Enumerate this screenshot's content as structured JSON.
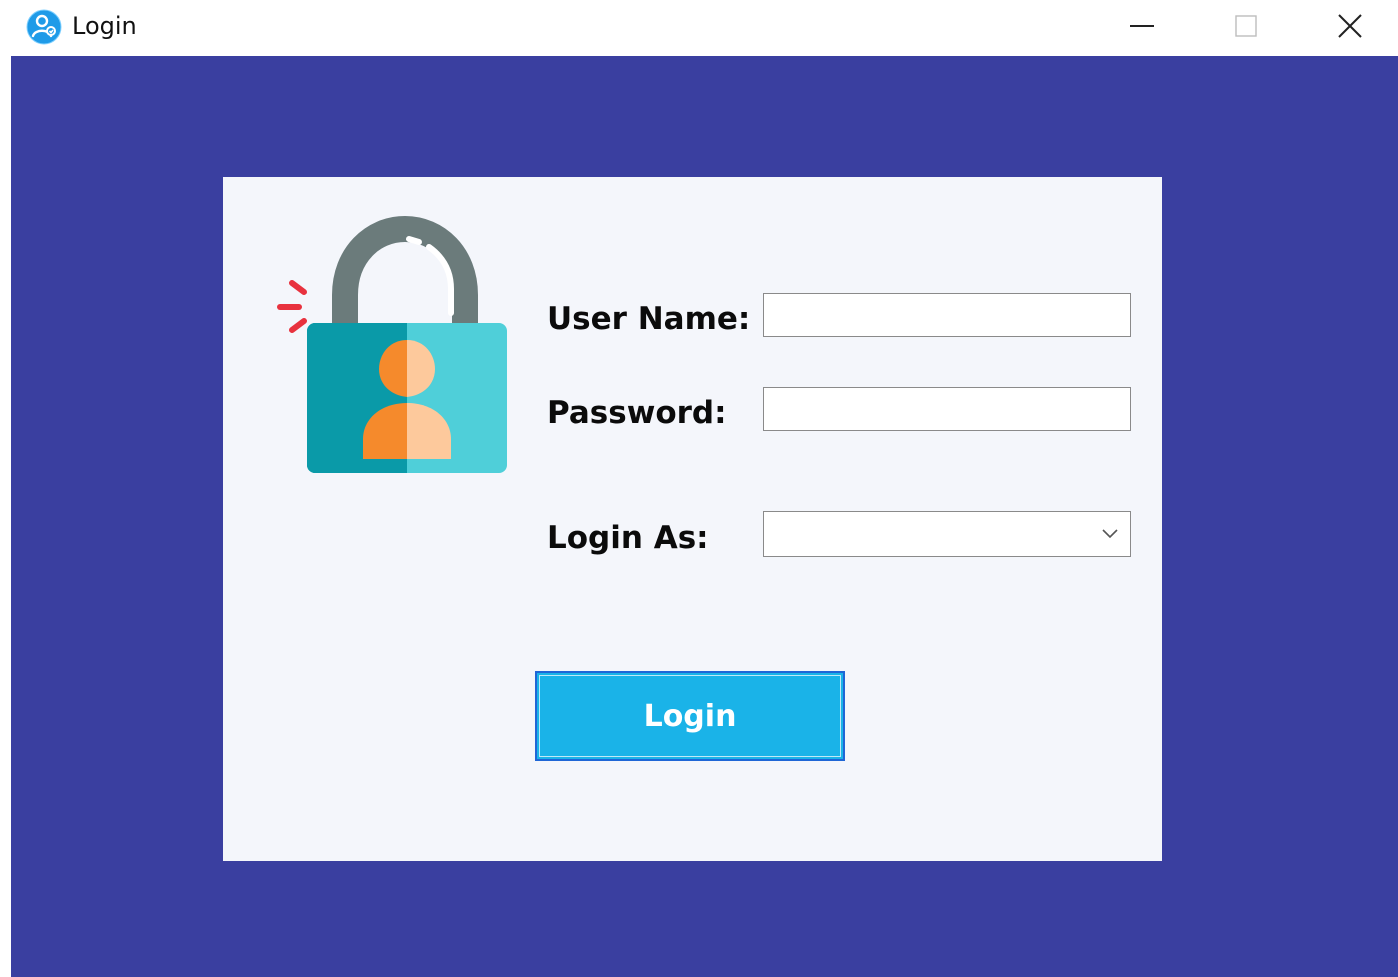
{
  "window": {
    "title": "Login"
  },
  "form": {
    "username_label": "User Name:",
    "username_value": "",
    "password_label": "Password:",
    "password_value": "",
    "role_label": "Login As:",
    "role_selected": "",
    "login_button": "Login"
  },
  "colors": {
    "background": "#3a3fa0",
    "panel": "#f4f6fb",
    "button": "#1ab3e8",
    "button_border": "#1f66d6"
  },
  "icons": {
    "app": "user-circle-icon",
    "hero": "padlock-user-icon",
    "minimize": "minimize-icon",
    "maximize": "maximize-icon",
    "close": "close-icon",
    "dropdown": "chevron-down-icon"
  }
}
